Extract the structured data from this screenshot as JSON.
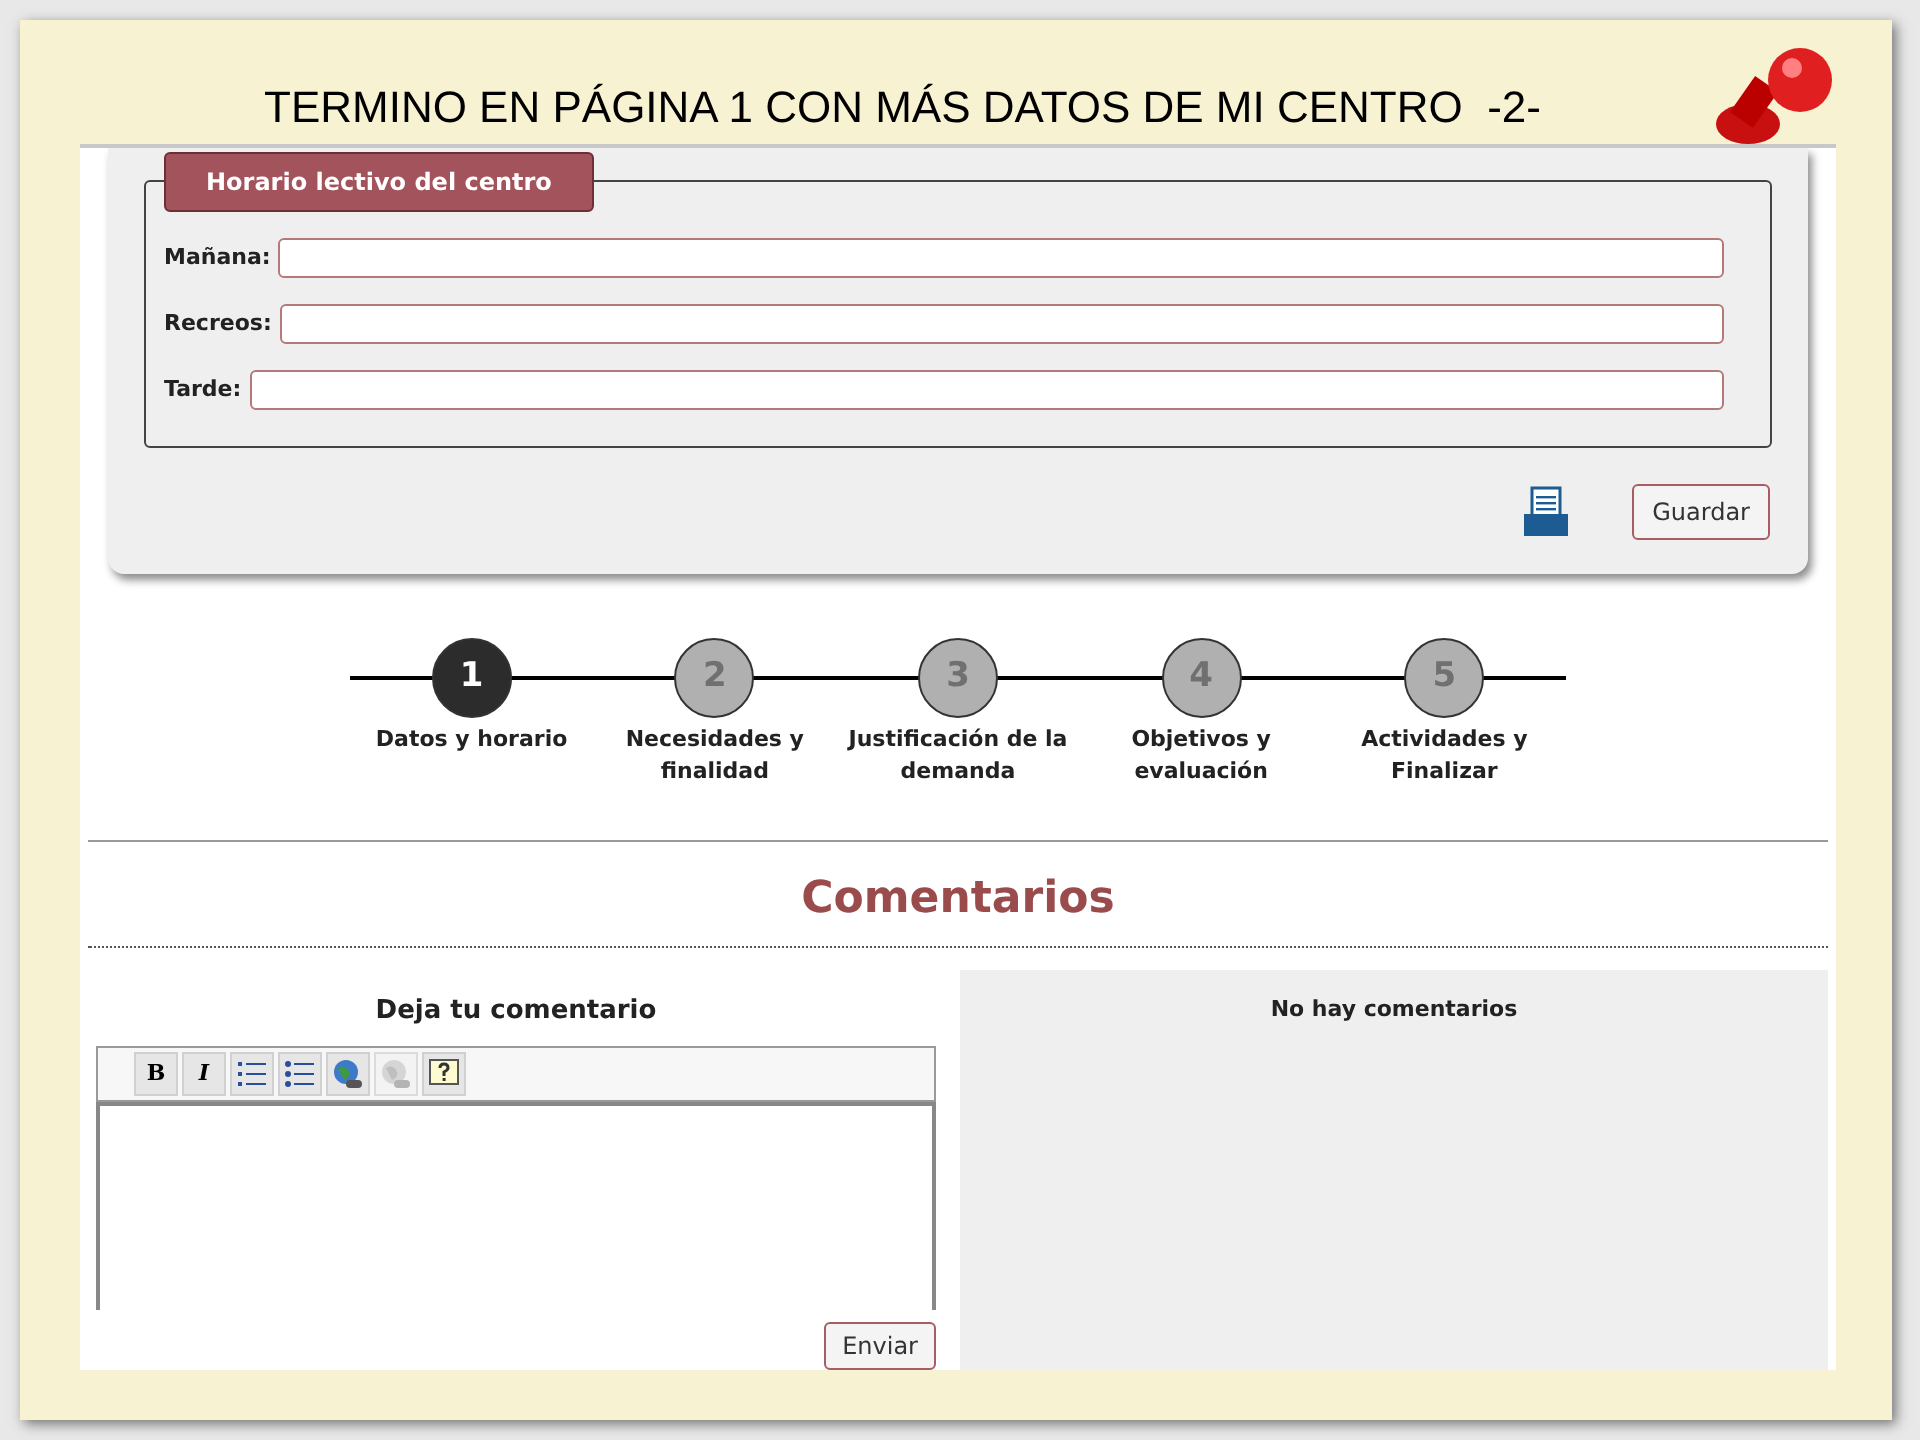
{
  "slide": {
    "title": "TERMINO EN PÁGINA 1 CON MÁS DATOS DE MI CENTRO  -2-"
  },
  "schedule": {
    "legend": "Horario lectivo del centro",
    "fields": [
      {
        "label": "Mañana:"
      },
      {
        "label": "Recreos:"
      },
      {
        "label": "Tarde:"
      }
    ],
    "save_button": "Guardar"
  },
  "steps": [
    {
      "number": "1",
      "label": "Datos y horario",
      "selected": true
    },
    {
      "number": "2",
      "label": "Necesidades y finalidad",
      "selected": false
    },
    {
      "number": "3",
      "label": "Justificación de la demanda",
      "selected": false
    },
    {
      "number": "4",
      "label": "Objetivos y evaluación",
      "selected": false
    },
    {
      "number": "5",
      "label": "Actividades y Finalizar",
      "selected": false
    }
  ],
  "comments": {
    "title": "Comentarios",
    "form_title": "Deja tu comentario",
    "toolbar": [
      {
        "kind": "bold",
        "label": "B",
        "disabled": false
      },
      {
        "kind": "italic",
        "label": "I",
        "disabled": false
      },
      {
        "kind": "ordered-list",
        "disabled": false
      },
      {
        "kind": "bullet-list",
        "disabled": false
      },
      {
        "kind": "link",
        "disabled": false
      },
      {
        "kind": "unlink",
        "disabled": true
      },
      {
        "kind": "help",
        "disabled": false
      }
    ],
    "send_button": "Enviar",
    "empty_message": "No hay comentarios"
  }
}
